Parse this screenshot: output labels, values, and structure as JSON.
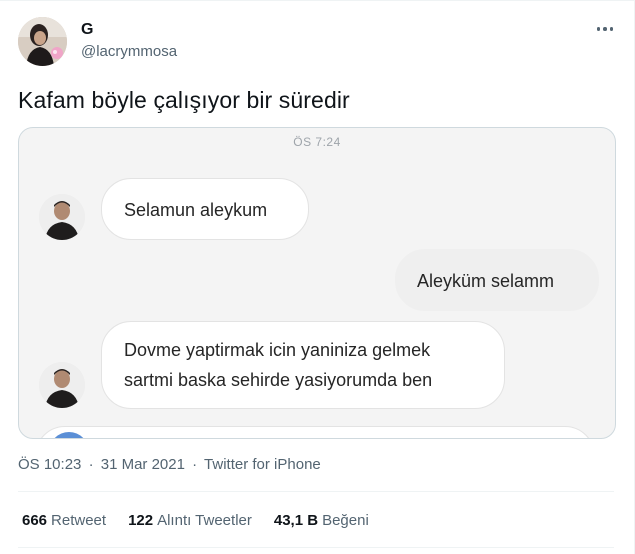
{
  "author": {
    "display_name": "G",
    "handle": "@lacrymmosa"
  },
  "tweet": {
    "text": "Kafam böyle çalışıyor bir süredir"
  },
  "media": {
    "chat_time": "ÖS 7:24",
    "messages": [
      {
        "direction": "incoming",
        "text": "Selamun aleykum"
      },
      {
        "direction": "outgoing",
        "text": "Aleyküm selamm"
      },
      {
        "direction": "incoming",
        "text": "Dovme yaptirmak icin yaniniza gelmek\nsartmi baska sehirde yasiyorumda ben"
      }
    ]
  },
  "meta": {
    "time": "ÖS 10:23",
    "separator": "·",
    "date": "31 Mar 2021",
    "source": "Twitter for iPhone"
  },
  "stats": {
    "retweets_count": "666",
    "retweets_label": "Retweet",
    "quotes_count": "122",
    "quotes_label": "Alıntı Tweetler",
    "likes_count": "43,1 B",
    "likes_label": "Beğeni"
  },
  "colors": {
    "primary_text": "#0f1419",
    "secondary_text": "#536471",
    "border": "#cfd9de",
    "divider": "#eff3f4"
  },
  "icons": {
    "more": "more-horizontal-icon"
  }
}
